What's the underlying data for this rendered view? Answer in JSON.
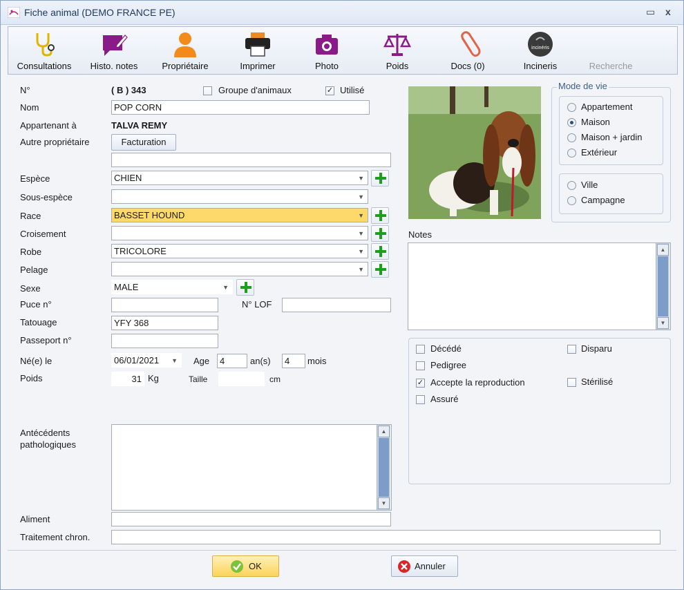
{
  "window": {
    "title": "Fiche animal (DEMO FRANCE PE)",
    "minimize": "▭",
    "close": "x"
  },
  "toolbar": {
    "consultations": "Consultations",
    "histo_notes": "Histo. notes",
    "proprietaire": "Propriétaire",
    "imprimer": "Imprimer",
    "photo": "Photo",
    "poids": "Poids",
    "docs": "Docs (0)",
    "incineris": "Incineris",
    "incineris_logo_text": "incinéris",
    "recherche": "Recherche"
  },
  "form": {
    "numero_label": "N°",
    "numero_value": "( B ) 343",
    "groupe_label": "Groupe d'animaux",
    "groupe_checked": false,
    "utilise_label": "Utilisé",
    "utilise_checked": true,
    "nom_label": "Nom",
    "nom_value": "POP CORN",
    "appartenant_label": "Appartenant à",
    "appartenant_value": "TALVA REMY",
    "autre_prop_label": "Autre propriétaire",
    "facturation_button": "Facturation",
    "autre_prop_value": "",
    "espece_label": "Espèce",
    "espece_value": "CHIEN",
    "sous_espece_label": "Sous-espèce",
    "sous_espece_value": "",
    "race_label": "Race",
    "race_value": "BASSET HOUND",
    "croisement_label": "Croisement",
    "croisement_value": "",
    "robe_label": "Robe",
    "robe_value": "TRICOLORE",
    "pelage_label": "Pelage",
    "pelage_value": "",
    "sexe_label": "Sexe",
    "sexe_value": "MALE",
    "puce_label": "Puce n°",
    "puce_value": "",
    "lof_label": "N° LOF",
    "lof_value": "",
    "tatouage_label": "Tatouage",
    "tatouage_value": "YFY 368",
    "passeport_label": "Passeport n°",
    "passeport_value": "",
    "ne_label": "Né(e) le",
    "ne_value": "06/01/2021",
    "age_label": "Age",
    "age_years": "4",
    "ans_label": "an(s)",
    "age_months": "4",
    "mois_label": "mois",
    "poids_label": "Poids",
    "poids_value": "31",
    "kg_label": "Kg",
    "taille_label": "Taille",
    "taille_value": "",
    "cm_label": "cm",
    "antecedents_label_1": "Antécédents",
    "antecedents_label_2": "pathologiques",
    "antecedents_value": "",
    "aliment_label": "Aliment",
    "aliment_value": "",
    "traitement_label": "Traitement chron.",
    "traitement_value": ""
  },
  "mode_de_vie": {
    "title": "Mode de vie",
    "habitat": [
      {
        "label": "Appartement",
        "selected": false
      },
      {
        "label": "Maison",
        "selected": true
      },
      {
        "label": "Maison + jardin",
        "selected": false
      },
      {
        "label": "Extérieur",
        "selected": false
      }
    ],
    "zone": [
      {
        "label": "Ville",
        "selected": false
      },
      {
        "label": "Campagne",
        "selected": false
      }
    ]
  },
  "notes": {
    "label": "Notes",
    "value": ""
  },
  "status": {
    "decede": {
      "label": "Décédé",
      "checked": false
    },
    "disparu": {
      "label": "Disparu",
      "checked": false
    },
    "pedigree": {
      "label": "Pedigree",
      "checked": false
    },
    "reproduction": {
      "label": "Accepte la reproduction",
      "checked": true
    },
    "sterilise": {
      "label": "Stérilisé",
      "checked": false
    },
    "assure": {
      "label": "Assuré",
      "checked": false
    }
  },
  "footer": {
    "ok": "OK",
    "annuler": "Annuler"
  },
  "colors": {
    "highlight_field": "#fcd96a",
    "accent_green": "#1aa01a",
    "purple": "#8a1a8a",
    "orange": "#f28a1c"
  }
}
